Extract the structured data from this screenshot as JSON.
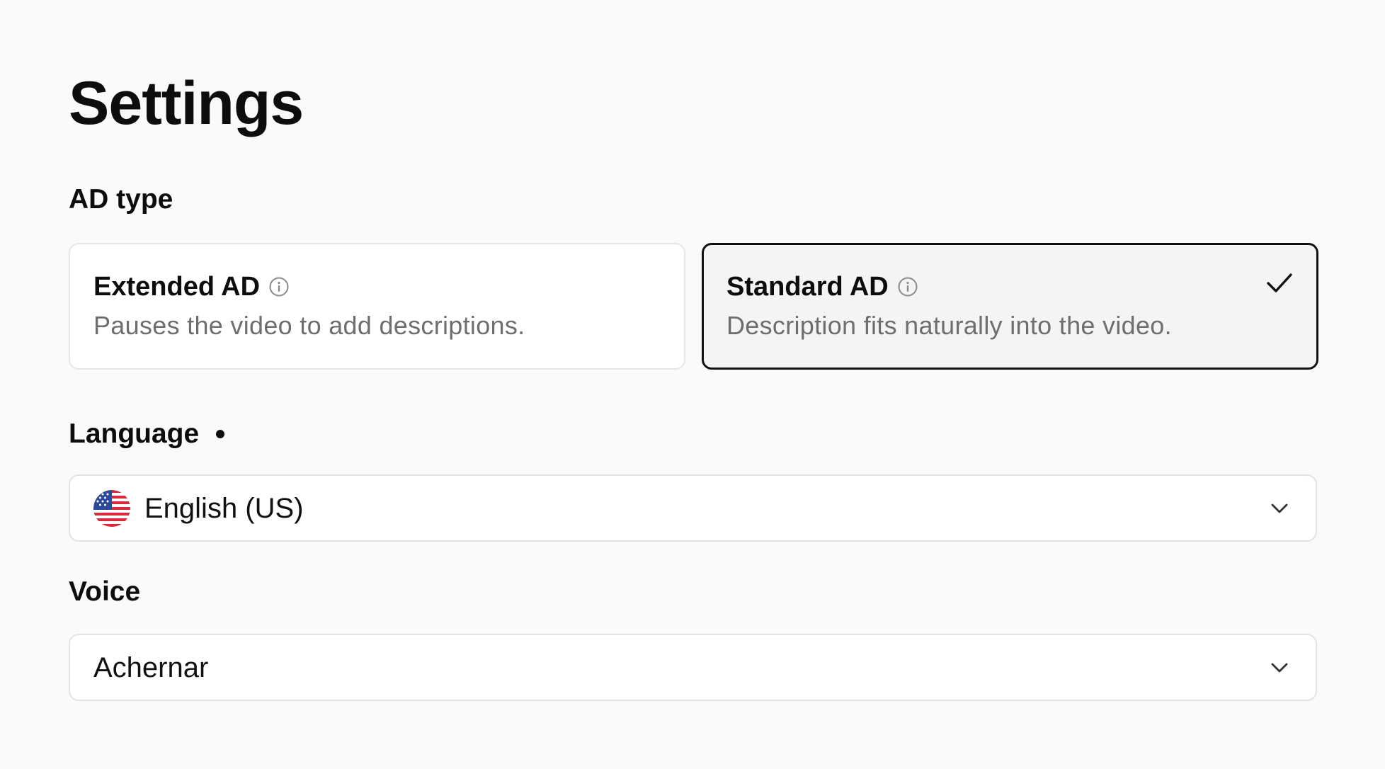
{
  "page": {
    "title": "Settings"
  },
  "ad_type": {
    "label": "AD type",
    "options": [
      {
        "title": "Extended AD",
        "description": "Pauses the video to add descriptions.",
        "icon": "info-icon",
        "selected": false
      },
      {
        "title": "Standard AD",
        "description": "Description fits naturally into the video.",
        "icon": "info-icon",
        "selected": true
      }
    ]
  },
  "language": {
    "label": "Language",
    "required": true,
    "value": "English (US)",
    "icon": "us-flag-icon"
  },
  "voice": {
    "label": "Voice",
    "value": "Achernar"
  },
  "colors": {
    "background": "#fafafa",
    "selected_border": "#111111",
    "muted_text": "#6e6e6e"
  }
}
